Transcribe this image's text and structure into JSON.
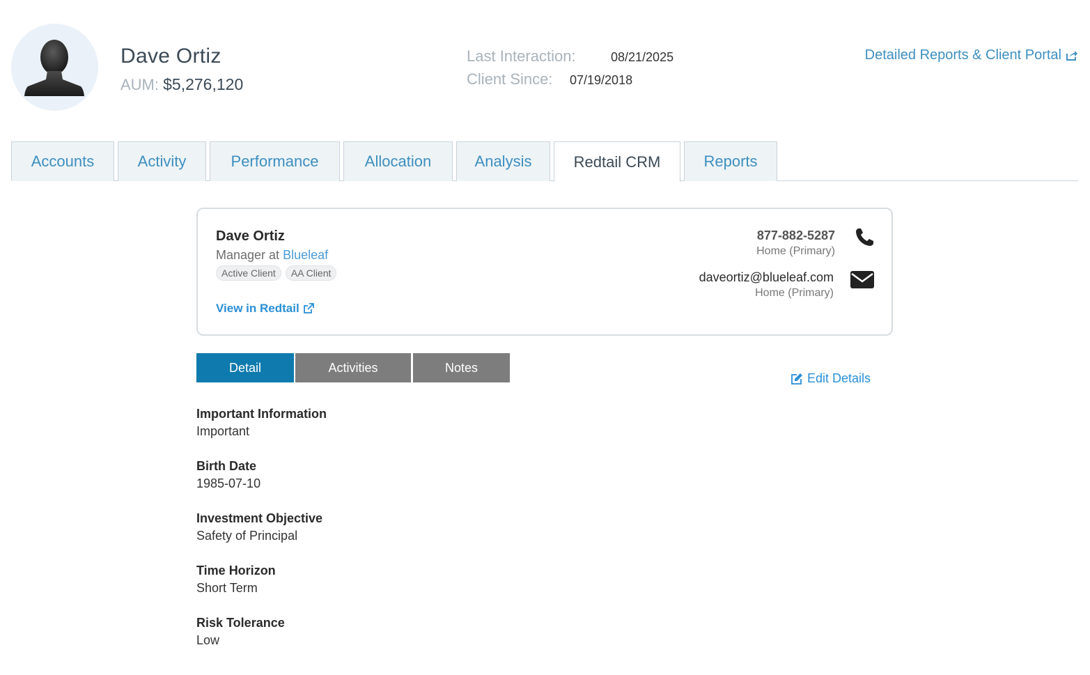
{
  "header": {
    "client_name": "Dave Ortiz",
    "aum_label": "AUM:",
    "aum_value": "$5,276,120",
    "last_interaction_label": "Last Interaction:",
    "last_interaction_value": "08/21/2025",
    "client_since_label": "Client Since:",
    "client_since_value": "07/19/2018",
    "portal_link": "Detailed Reports & Client Portal",
    "portal_icon": "external-share-icon"
  },
  "tabs": [
    {
      "label": "Accounts"
    },
    {
      "label": "Activity"
    },
    {
      "label": "Performance"
    },
    {
      "label": "Allocation"
    },
    {
      "label": "Analysis"
    },
    {
      "label": "Redtail CRM",
      "active": true
    },
    {
      "label": "Reports"
    }
  ],
  "card": {
    "name": "Dave Ortiz",
    "role_prefix": "Manager at",
    "company": "Blueleaf",
    "tags": [
      "Active Client",
      "AA Client"
    ],
    "redtail_link": "View in Redtail",
    "phone": "877-882-5287",
    "phone_type": "Home (Primary)",
    "email": "daveortiz@blueleaf.com",
    "email_type": "Home (Primary)"
  },
  "subtabs": [
    {
      "label": "Detail",
      "active": true
    },
    {
      "label": "Activities"
    },
    {
      "label": "Notes"
    }
  ],
  "edit_link": "Edit Details",
  "details": [
    {
      "label": "Important Information",
      "value": "Important"
    },
    {
      "label": "Birth Date",
      "value": "1985-07-10"
    },
    {
      "label": "Investment Objective",
      "value": "Safety of Principal"
    },
    {
      "label": "Time Horizon",
      "value": "Short Term"
    },
    {
      "label": "Risk Tolerance",
      "value": "Low"
    }
  ],
  "colors": {
    "accent": "#3d8fc0",
    "link": "#2a8fd6",
    "active_subtab": "#0f7aad",
    "inactive_subtab": "#7d7d7d"
  }
}
